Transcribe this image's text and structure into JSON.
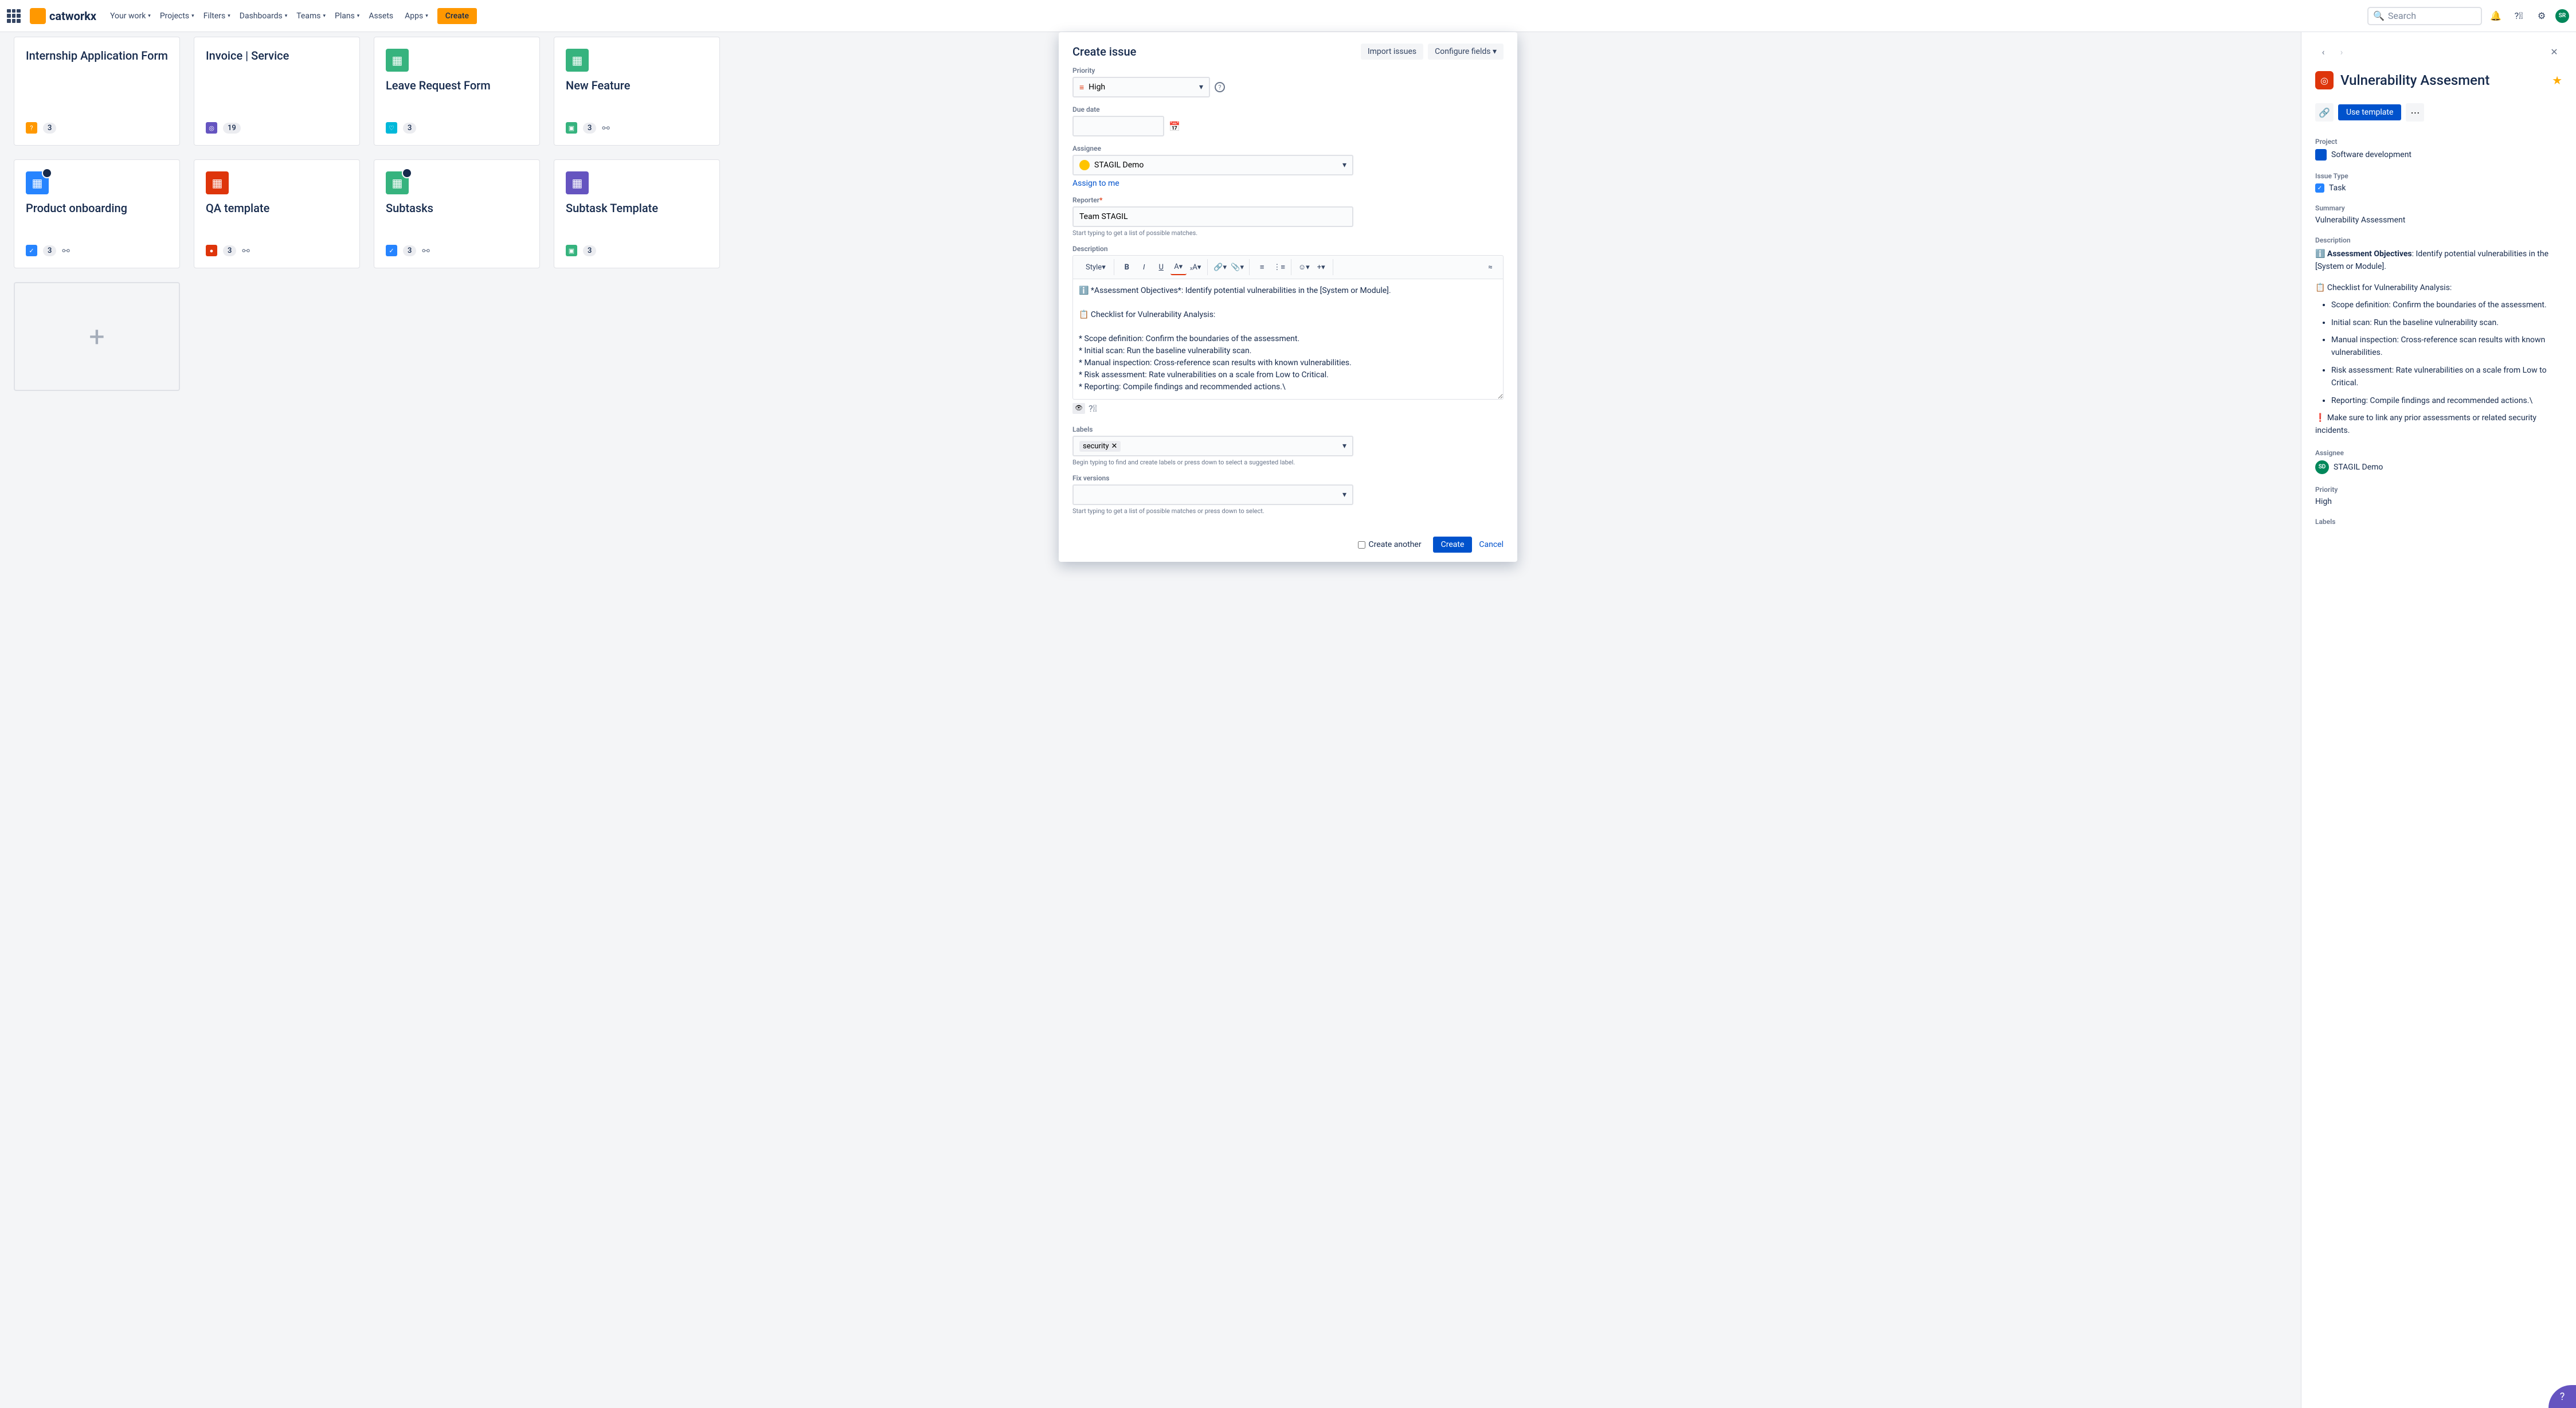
{
  "nav": {
    "logo_text": "catworkx",
    "items": [
      "Your work",
      "Projects",
      "Filters",
      "Dashboards",
      "Teams",
      "Plans",
      "Assets",
      "Apps"
    ],
    "create": "Create",
    "search_placeholder": "Search",
    "avatar_initials": "SR"
  },
  "cards": [
    {
      "title": "Internship Application Form",
      "type_color": "#ff9800",
      "type_glyph": "?",
      "count": "3",
      "has_icon": false
    },
    {
      "title": "Invoice | Service",
      "type_color": "#6554c0",
      "type_glyph": "◎",
      "count": "19",
      "has_icon": false
    },
    {
      "title": "Leave Request Form",
      "type_color": "#00b8d9",
      "type_glyph": "♡",
      "count": "3",
      "has_icon": true,
      "icon_bg": "#36b37e"
    },
    {
      "title": "New Feature",
      "type_color": "#36b37e",
      "type_glyph": "▣",
      "count": "3",
      "has_icon": true,
      "icon_bg": "#36b37e",
      "has_tree": true
    },
    {
      "title": "Product onboarding",
      "type_color": "#2684ff",
      "type_glyph": "✓",
      "count": "3",
      "has_icon": true,
      "icon_bg": "#2684ff",
      "has_tree": true,
      "has_overlay": true
    },
    {
      "title": "QA template",
      "type_color": "#de350b",
      "type_glyph": "●",
      "count": "3",
      "has_icon": true,
      "icon_bg": "#de350b",
      "has_tree": true
    },
    {
      "title": "Subtasks",
      "type_color": "#2684ff",
      "type_glyph": "✓",
      "count": "3",
      "has_icon": true,
      "icon_bg": "#36b37e",
      "has_tree": true,
      "has_overlay": true
    },
    {
      "title": "Subtask Template",
      "type_color": "#36b37e",
      "type_glyph": "▣",
      "count": "3",
      "has_icon": true,
      "icon_bg": "#6554c0"
    }
  ],
  "modal": {
    "title": "Create issue",
    "import": "Import issues",
    "configure": "Configure fields",
    "priority_label": "Priority",
    "priority_value": "High",
    "due_date_label": "Due date",
    "assignee_label": "Assignee",
    "assignee_value": "STAGIL Demo",
    "assign_to_me": "Assign to me",
    "reporter_label": "Reporter",
    "reporter_value": "Team STAGIL",
    "reporter_help": "Start typing to get a list of possible matches.",
    "description_label": "Description",
    "style_btn": "Style",
    "description_text": "ℹ️ *Assessment Objectives*: Identify potential vulnerabilities in the [System or Module].\n\n📋 Checklist for Vulnerability Analysis:\n\n* Scope definition: Confirm the boundaries of the assessment.\n* Initial scan: Run the baseline vulnerability scan.\n* Manual inspection: Cross-reference scan results with known vulnerabilities.\n* Risk assessment: Rate vulnerabilities on a scale from Low to Critical.\n* Reporting: Compile findings and recommended actions.\\",
    "labels_label": "Labels",
    "labels_value": "security",
    "labels_help": "Begin typing to find and create labels or press down to select a suggested label.",
    "fixversions_label": "Fix versions",
    "fixversions_help": "Start typing to get a list of possible matches or press down to select.",
    "create_another": "Create another",
    "create_btn": "Create",
    "cancel_btn": "Cancel"
  },
  "panel": {
    "title": "Vulnerability Assesment",
    "use_template": "Use template",
    "project_label": "Project",
    "project_value": "Software development",
    "issuetype_label": "Issue Type",
    "issuetype_value": "Task",
    "summary_label": "Summary",
    "summary_value": "Vulnerability Assessment",
    "description_label": "Description",
    "desc_intro_strong": "Assessment Objectives",
    "desc_intro_rest": ": Identify potential vulnerabilities in the [System or Module].",
    "desc_checklist": "📋 Checklist for Vulnerability Analysis:",
    "desc_items": [
      "Scope definition: Confirm the boundaries of the assessment.",
      "Initial scan: Run the baseline vulnerability scan.",
      "Manual inspection: Cross-reference scan results with known vulnerabilities.",
      "Risk assessment: Rate vulnerabilities on a scale from Low to Critical.",
      "Reporting: Compile findings and recommended actions.\\"
    ],
    "desc_footer": "❗ Make sure to link any prior assessments or related security incidents.",
    "assignee_label": "Assignee",
    "assignee_value": "STAGIL Demo",
    "assignee_initials": "SD",
    "priority_label": "Priority",
    "priority_value": "High",
    "labels_label": "Labels"
  }
}
